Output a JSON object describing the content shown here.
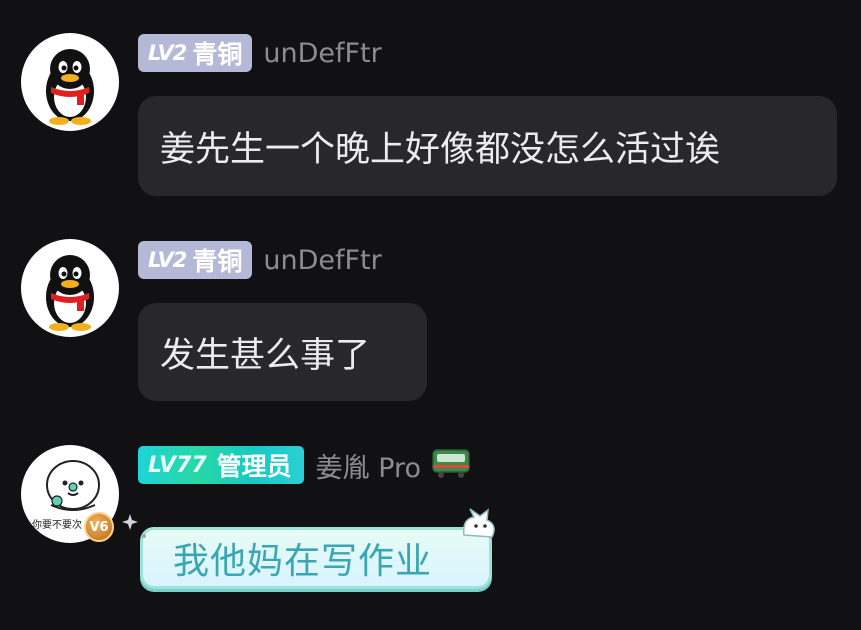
{
  "messages": [
    {
      "level_badge": "LV2",
      "rank": "青铜",
      "username": "unDefFtr",
      "text": "姜先生一个晚上好像都没怎么活过诶",
      "avatar_icon": "qq-penguin-icon"
    },
    {
      "level_badge": "LV2",
      "rank": "青铜",
      "username": "unDefFtr",
      "text": "发生甚么事了",
      "avatar_icon": "qq-penguin-icon"
    },
    {
      "level_badge": "LV77",
      "rank": "管理员",
      "username": "姜胤 Pro",
      "text": "我他妈在写作业",
      "avatar_caption": "你要不要次",
      "vip_badge": "V6",
      "avatar_icon": "cartoon-meme-icon",
      "name_icon": "train-icon"
    }
  ],
  "colors": {
    "background": "#111113",
    "bubble": "#28282b",
    "level_badge": "#b5b9d8",
    "admin_badge": "#1fd3d8",
    "username": "#8b8b92",
    "fancy_bubble_text": "#3aa6b3"
  }
}
